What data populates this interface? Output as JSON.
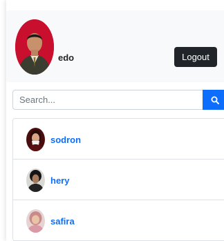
{
  "profile": {
    "name": "edo",
    "avatar_icon": "user-photo",
    "logout_label": "Logout"
  },
  "search": {
    "placeholder": "Search...",
    "value": "",
    "button_icon": "search-icon"
  },
  "users": [
    {
      "name": "sodron",
      "avatar_icon": "user-photo"
    },
    {
      "name": "hery",
      "avatar_icon": "user-photo"
    },
    {
      "name": "safira",
      "avatar_icon": "user-photo"
    }
  ],
  "colors": {
    "primary": "#0d6efd",
    "dark": "#212529",
    "card_bg": "#f8f9fa",
    "border": "#dee2e6"
  }
}
